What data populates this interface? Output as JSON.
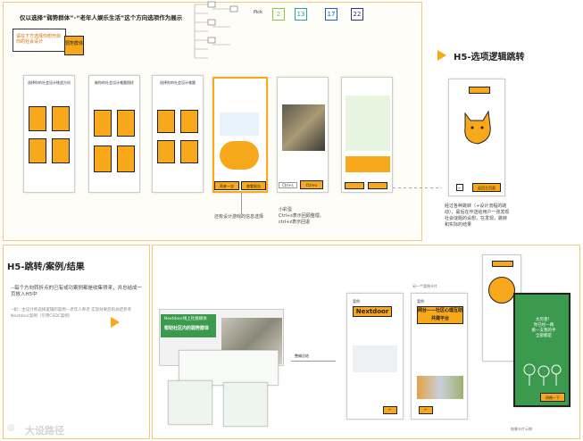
{
  "top": {
    "caption": "仅以选择“弱势群体”-“老年人娱乐生活”这个方向选项作为展示",
    "banner_text": "请在下方选择你想开启你的社会设计",
    "banner_btn": "弱势群体",
    "pick_label": "Pick",
    "pick_numbers": [
      "2",
      "13",
      "17",
      "22"
    ],
    "screen_note_1": "选择你的社会设计挑战方向",
    "screen_note_2": "被你的社会设计难题困扰",
    "screen_note_3": "选择你的社会设计难题",
    "bottom_btns": [
      "再来一次",
      "查看报告"
    ],
    "ctrl_keys": [
      "Ctrl+s",
      "Ctrl+v"
    ],
    "other_note": "还有设计游戏的信息选择",
    "ctrl_note": "小彩蛋\nCtrl+s表示回顾整理。\nctrl+z表示回退",
    "h5_title": "H5-选项逻辑跳转",
    "h5_note": "经过各种跳转（+设计流程的跳动），最后在作送给用户一张发现社会谜题的设想，在发现，跳转和实际的结果",
    "h5_back_btn": "返回主页面"
  },
  "bottom": {
    "title": "H5-跳转/案例/结果",
    "desc": "--每个方向转折点的已有或功案例都是收集得来，并总结成一页放入H5中",
    "desc_sub": "--如：主设计师选择逻辑的案例—老年人养老·实现效果后的总结参考Nextdoor案例（引用CSDC案例）",
    "web_title": "Nextdoor线上社群媒体",
    "web_sub": "帮助社区内的弱势群体",
    "summary_label": "整编总结",
    "card1_label": "案例",
    "card1_title": "Nextdoor",
    "card2_label": "案例",
    "card2_title": "网台——社区心理互助共建平台",
    "more_label": "另一个案例卡片",
    "result_text": "太厉害！\n你已经一路\n挑一支我的手\n全部都是",
    "result_btn": "再做一下",
    "result_caption": "结果卡片示例"
  },
  "watermark": "大设路径"
}
